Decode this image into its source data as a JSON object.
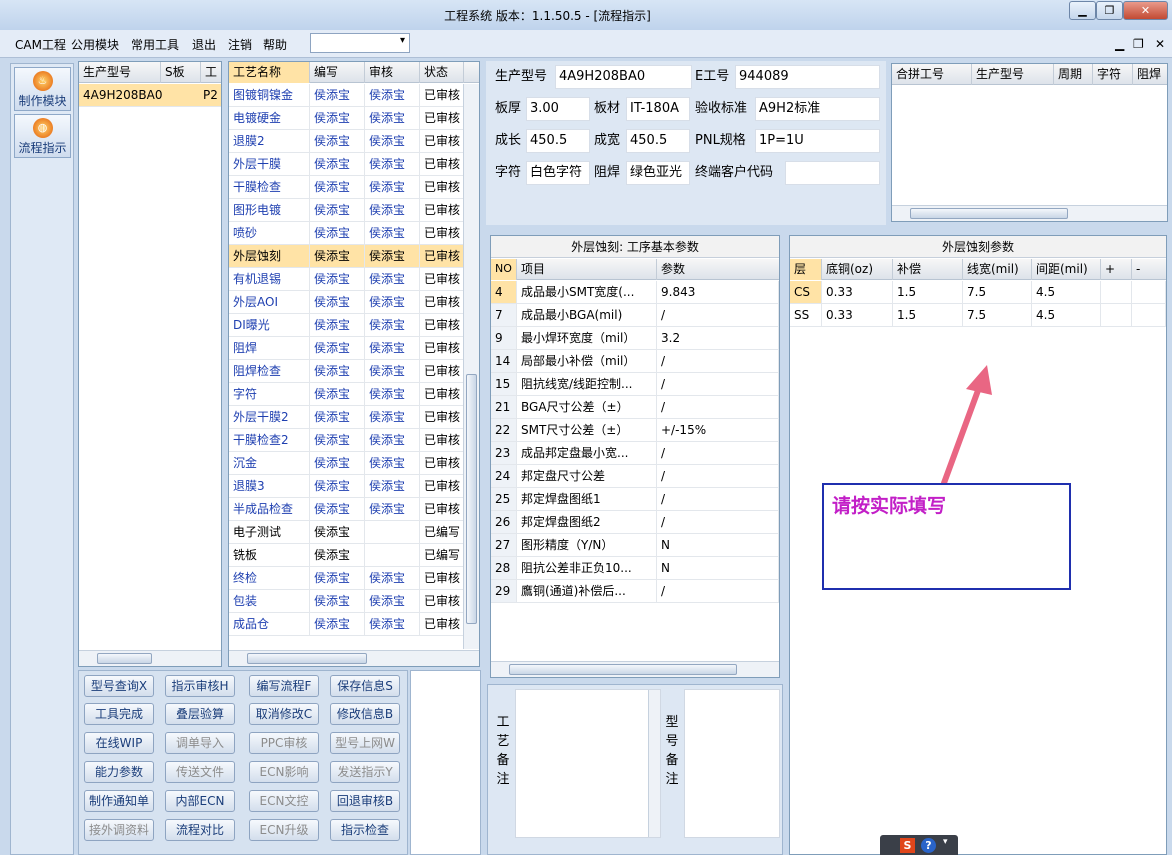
{
  "window": {
    "title": "工程系统   版本：1.1.50.5 - [流程指示]",
    "min": "▁",
    "max": "❐",
    "close": "✕"
  },
  "menu": [
    "CAM工程",
    "公用模块",
    "常用工具",
    "退出",
    "注销",
    "帮助"
  ],
  "combo": {
    "value": "",
    "arrow": "▾"
  },
  "mdi": {
    "min": "▁",
    "restore": "❐",
    "close": "✕"
  },
  "nav": [
    {
      "label": "制作模块",
      "icon": "flame-icon"
    },
    {
      "label": "流程指示",
      "icon": "flow-icon"
    }
  ],
  "models": {
    "headers": [
      "生产型号",
      "S板",
      "工"
    ],
    "rows": [
      [
        "4A9H208BA0",
        "",
        "P2"
      ]
    ]
  },
  "process": {
    "headers": [
      "工艺名称",
      "编写",
      "审核",
      "状态"
    ],
    "rows": [
      [
        "图镀铜镍金",
        "侯添宝",
        "侯添宝",
        "已审核"
      ],
      [
        "电镀硬金",
        "侯添宝",
        "侯添宝",
        "已审核"
      ],
      [
        "退膜2",
        "侯添宝",
        "侯添宝",
        "已审核"
      ],
      [
        "外层干膜",
        "侯添宝",
        "侯添宝",
        "已审核"
      ],
      [
        "干膜检查",
        "侯添宝",
        "侯添宝",
        "已审核"
      ],
      [
        "图形电镀",
        "侯添宝",
        "侯添宝",
        "已审核"
      ],
      [
        "喷砂",
        "侯添宝",
        "侯添宝",
        "已审核"
      ],
      [
        "外层蚀刻",
        "侯添宝",
        "侯添宝",
        "已审核"
      ],
      [
        "有机退锡",
        "侯添宝",
        "侯添宝",
        "已审核"
      ],
      [
        "外层AOI",
        "侯添宝",
        "侯添宝",
        "已审核"
      ],
      [
        "DI曝光",
        "侯添宝",
        "侯添宝",
        "已审核"
      ],
      [
        "阻焊",
        "侯添宝",
        "侯添宝",
        "已审核"
      ],
      [
        "阻焊检查",
        "侯添宝",
        "侯添宝",
        "已审核"
      ],
      [
        "字符",
        "侯添宝",
        "侯添宝",
        "已审核"
      ],
      [
        "外层干膜2",
        "侯添宝",
        "侯添宝",
        "已审核"
      ],
      [
        "干膜检查2",
        "侯添宝",
        "侯添宝",
        "已审核"
      ],
      [
        "沉金",
        "侯添宝",
        "侯添宝",
        "已审核"
      ],
      [
        "退膜3",
        "侯添宝",
        "侯添宝",
        "已审核"
      ],
      [
        "半成品检查",
        "侯添宝",
        "侯添宝",
        "已审核"
      ],
      [
        "电子测试",
        "侯添宝",
        "",
        "已编写"
      ],
      [
        "铣板",
        "侯添宝",
        "",
        "已编写"
      ],
      [
        "终检",
        "侯添宝",
        "侯添宝",
        "已审核"
      ],
      [
        "包装",
        "侯添宝",
        "侯添宝",
        "已审核"
      ],
      [
        "成品仓",
        "侯添宝",
        "侯添宝",
        "已审核"
      ]
    ]
  },
  "buttons": [
    [
      "型号查询X",
      "指示审核H",
      "编写流程F",
      "保存信息S"
    ],
    [
      "工具完成",
      "叠层验算",
      "取消修改C",
      "修改信息B"
    ],
    [
      "在线WIP",
      "调单导入",
      "PPC审核",
      "型号上网W"
    ],
    [
      "能力参数",
      "传送文件",
      "ECN影响",
      "发送指示Y"
    ],
    [
      "制作通知单",
      "内部ECN",
      "ECN文控",
      "回退审核B"
    ],
    [
      "接外调资料",
      "流程对比",
      "ECN升级",
      "指示检查"
    ]
  ],
  "info": {
    "model_label": "生产型号",
    "model": "4A9H208BA0",
    "eng_label": "E工号",
    "eng": "944089",
    "thick_label": "板厚",
    "thick": "3.00",
    "mat_label": "板材",
    "mat": "IT-180A",
    "std_label": "验收标准",
    "std": "A9H2标准",
    "len_label": "成长",
    "len": "450.5",
    "wid_label": "成宽",
    "wid": "450.5",
    "pnl_label": "PNL规格",
    "pnl": "1P=1U",
    "char_label": "字符",
    "char": "白色字符",
    "sm_label": "阻焊",
    "sm": "绿色亚光",
    "cust_label": "终端客户代码",
    "cust": ""
  },
  "combine": {
    "headers": [
      "合拼工号",
      "生产型号",
      "周期",
      "字符",
      "阻焊"
    ]
  },
  "params": {
    "title": "外层蚀刻: 工序基本参数",
    "headers": [
      "NO",
      "项目",
      "参数"
    ],
    "rows": [
      [
        "4",
        "成品最小SMT宽度(...",
        "9.843"
      ],
      [
        "7",
        "成品最小BGA(mil)",
        "/"
      ],
      [
        "9",
        "最小焊环宽度（mil）",
        "3.2"
      ],
      [
        "14",
        "局部最小补偿（mil）",
        "/"
      ],
      [
        "15",
        "阻抗线宽/线距控制...",
        "/"
      ],
      [
        "21",
        "BGA尺寸公差（±）",
        "/"
      ],
      [
        "22",
        "SMT尺寸公差（±）",
        "+/-15%"
      ],
      [
        "23",
        "成品邦定盘最小宽...",
        "/"
      ],
      [
        "24",
        "邦定盘尺寸公差",
        "/"
      ],
      [
        "25",
        "邦定焊盘图纸1",
        "/"
      ],
      [
        "26",
        "邦定焊盘图纸2",
        "/"
      ],
      [
        "27",
        "图形精度（Y/N）",
        "N"
      ],
      [
        "28",
        "阻抗公差非正负10...",
        "N"
      ],
      [
        "29",
        "鷹铜(通道)补偿后...",
        "/"
      ]
    ]
  },
  "etch": {
    "title": "外层蚀刻参数",
    "headers": [
      "层",
      "底铜(oz)",
      "补偿",
      "线宽(mil)",
      "间距(mil)",
      "+",
      "-"
    ],
    "rows": [
      [
        "CS",
        "0.33",
        "1.5",
        "7.5",
        "4.5"
      ],
      [
        "SS",
        "0.33",
        "1.5",
        "7.5",
        "4.5"
      ]
    ]
  },
  "note": {
    "text": "请按实际填写"
  },
  "remarks": {
    "process_label": [
      "工",
      "艺",
      "备",
      "注"
    ],
    "model_label": [
      "型",
      "号",
      "备",
      "注"
    ]
  },
  "colors": {
    "accent": "#1e3fb0",
    "highlight": "#ffe3a6",
    "arrow": "#e96683",
    "note_text": "#c21fc7"
  }
}
